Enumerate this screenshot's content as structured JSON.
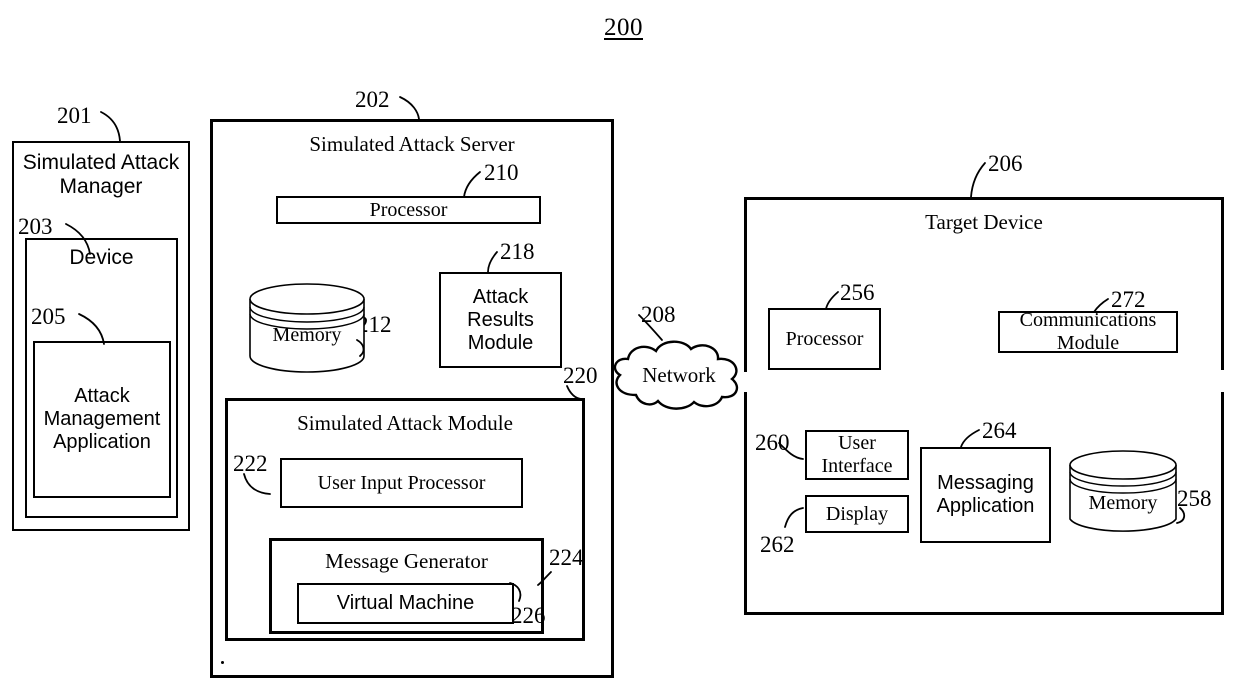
{
  "figure": {
    "number": "200"
  },
  "blocks": {
    "simulated_attack_manager": {
      "ref": "201",
      "title": "Simulated Attack\nManager"
    },
    "device": {
      "ref": "203",
      "title": "Device"
    },
    "attack_management_application": {
      "ref": "205",
      "title": "Attack\nManagement\nApplication"
    },
    "simulated_attack_server": {
      "ref": "202",
      "title": "Simulated Attack Server"
    },
    "server_processor": {
      "ref": "210",
      "title": "Processor"
    },
    "server_memory": {
      "ref": "212",
      "title": "Memory"
    },
    "attack_results_module": {
      "ref": "218",
      "title": "Attack\nResults\nModule"
    },
    "simulated_attack_module": {
      "ref": "220",
      "title": "Simulated Attack Module"
    },
    "user_input_processor": {
      "ref": "222",
      "title": "User Input Processor"
    },
    "message_generator": {
      "ref": "224",
      "title": "Message Generator"
    },
    "virtual_machine": {
      "ref": "226",
      "title": "Virtual Machine"
    },
    "network": {
      "ref": "208",
      "title": "Network"
    },
    "target_device": {
      "ref": "206",
      "title": "Target Device"
    },
    "target_processor": {
      "ref": "256",
      "title": "Processor"
    },
    "communications_module": {
      "ref": "272",
      "title": "Communications\nModule"
    },
    "user_interface": {
      "ref": "260",
      "title": "User\nInterface"
    },
    "display": {
      "ref": "262",
      "title": "Display"
    },
    "messaging_application": {
      "ref": "264",
      "title": "Messaging\nApplication"
    },
    "target_memory": {
      "ref": "258",
      "title": "Memory"
    }
  },
  "colors": {
    "stroke": "#000000",
    "background": "#ffffff"
  }
}
